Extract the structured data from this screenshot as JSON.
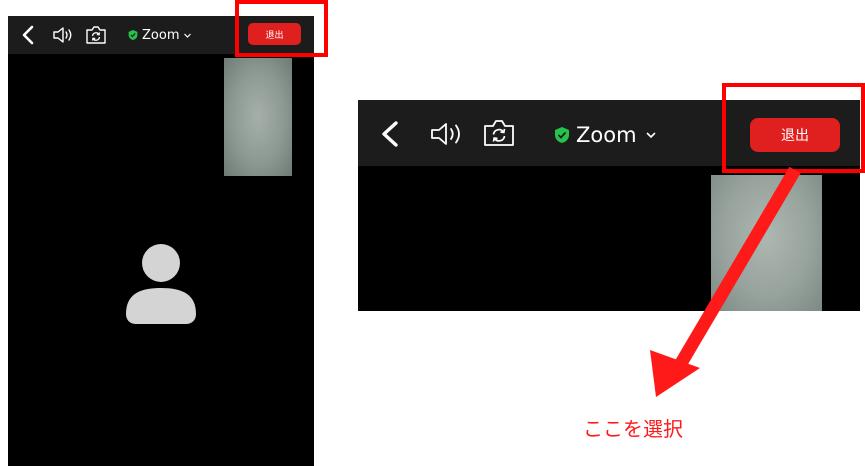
{
  "left_screen": {
    "meeting_name": "Zoom",
    "leave_label": "退出",
    "icons": [
      "back-icon",
      "speaker-icon",
      "camera-flip-icon",
      "shield-check-icon",
      "chevron-down-icon",
      "avatar-icon"
    ]
  },
  "right_screen": {
    "meeting_name": "Zoom",
    "leave_label": "退出",
    "icons": [
      "back-icon",
      "speaker-icon",
      "camera-flip-icon",
      "shield-check-icon",
      "chevron-down-icon"
    ]
  },
  "annotation": {
    "caption": "ここを選択",
    "highlight_color": "#ff0000"
  },
  "colors": {
    "toolbar": "#1c1c1c",
    "leave_button": "#e0201e",
    "shield": "#27c24c"
  }
}
